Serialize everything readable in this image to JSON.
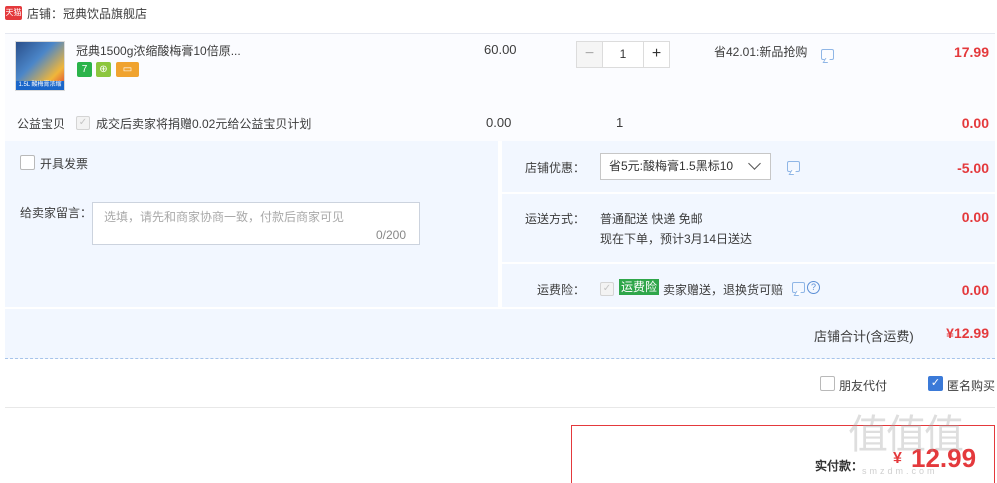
{
  "shop": {
    "badge": "天猫",
    "name": "店铺：冠典饮品旗舰店"
  },
  "item": {
    "thumb_tag": "1.5L 酸梅膏浓缩",
    "title": "冠典1500g浓缩酸梅膏10倍原...",
    "services": [
      "7",
      "⊕",
      "▭"
    ],
    "price": "60.00",
    "quantity": "1",
    "promo": "省42.01:新品抢购",
    "subtotal": "17.99"
  },
  "charity": {
    "label": "公益宝贝",
    "text": "成交后卖家将捐赠0.02元给公益宝贝计划",
    "price": "0.00",
    "qty": "1",
    "subtotal": "0.00"
  },
  "invoice": {
    "label": "开具发票"
  },
  "message": {
    "label": "给卖家留言：",
    "placeholder": "选填，请先和商家协商一致，付款后商家可见",
    "count": "0/200"
  },
  "discount": {
    "label": "店铺优惠：",
    "selected": "省5元:酸梅膏1.5黑标10",
    "value": "-5.00"
  },
  "shipping": {
    "label": "运送方式：",
    "method": "普通配送 快递 免邮",
    "eta": "现在下单，预计3月14日送达",
    "value": "0.00"
  },
  "insurance": {
    "label": "运费险：",
    "tag": "运费险",
    "text": "卖家赠送，退换货可赔",
    "value": "0.00"
  },
  "summary": {
    "label": "店铺合计(含运费)",
    "value": "¥12.99"
  },
  "options": {
    "friend_pay": "朋友代付",
    "anonymous": "匿名购买",
    "anonymous_checked": true
  },
  "payment": {
    "label": "实付款：",
    "currency": "¥",
    "value": "12.99"
  },
  "watermark": {
    "text": "值值值",
    "sub": "smzdm.com"
  },
  "colors": {
    "accent": "#e4393c",
    "panel": "#f2f7ff",
    "link": "#3b7ad8",
    "green": "#2fa64a"
  }
}
